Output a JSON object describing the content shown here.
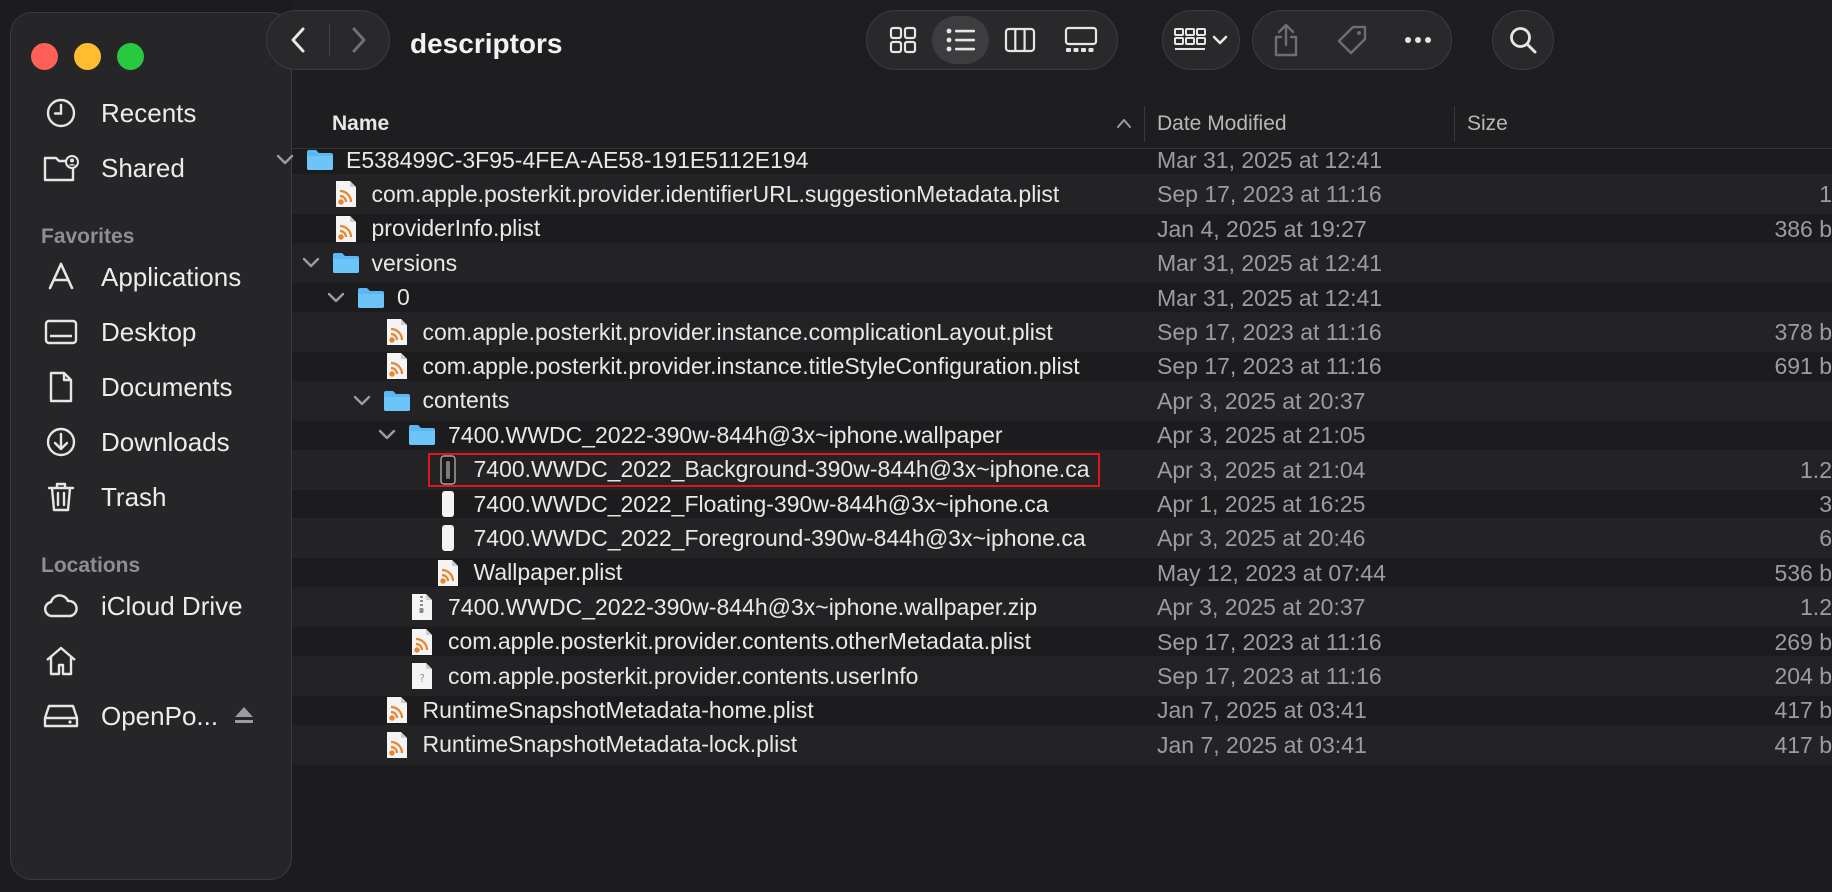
{
  "window": {
    "folder_title": "descriptors"
  },
  "sidebar": {
    "top_items": [
      {
        "label": "Recents",
        "icon": "clock-icon"
      },
      {
        "label": "Shared",
        "icon": "shared-folder-icon"
      }
    ],
    "favorites_title": "Favorites",
    "favorites": [
      {
        "label": "Applications",
        "icon": "applications-icon"
      },
      {
        "label": "Desktop",
        "icon": "desktop-icon"
      },
      {
        "label": "Documents",
        "icon": "document-icon"
      },
      {
        "label": "Downloads",
        "icon": "download-icon"
      },
      {
        "label": "Trash",
        "icon": "trash-icon"
      }
    ],
    "locations_title": "Locations",
    "locations": [
      {
        "label": "iCloud Drive",
        "icon": "cloud-icon"
      },
      {
        "label": "",
        "icon": "home-icon"
      },
      {
        "label": "OpenPo...",
        "icon": "drive-icon"
      }
    ]
  },
  "columns": {
    "name": "Name",
    "date": "Date Modified",
    "size": "Size"
  },
  "files": [
    {
      "name": "E538499C-3F95-4FEA-AE58-191E5112E194",
      "date": "Mar 31, 2025 at 12:41",
      "size": "",
      "level": 0,
      "type": "folder",
      "expanded": true
    },
    {
      "name": "com.apple.posterkit.provider.identifierURL.suggestionMetadata.plist",
      "date": "Sep 17, 2023 at 11:16",
      "size": "1",
      "level": 1,
      "type": "plist"
    },
    {
      "name": "providerInfo.plist",
      "date": "Jan 4, 2025 at 19:27",
      "size": "386 b",
      "level": 1,
      "type": "plist"
    },
    {
      "name": "versions",
      "date": "Mar 31, 2025 at 12:41",
      "size": "",
      "level": 1,
      "type": "folder",
      "expanded": true
    },
    {
      "name": "0",
      "date": "Mar 31, 2025 at 12:41",
      "size": "",
      "level": 2,
      "type": "folder",
      "expanded": true
    },
    {
      "name": "com.apple.posterkit.provider.instance.complicationLayout.plist",
      "date": "Sep 17, 2023 at 11:16",
      "size": "378 b",
      "level": 3,
      "type": "plist"
    },
    {
      "name": "com.apple.posterkit.provider.instance.titleStyleConfiguration.plist",
      "date": "Sep 17, 2023 at 11:16",
      "size": "691 b",
      "level": 3,
      "type": "plist"
    },
    {
      "name": "contents",
      "date": "Apr 3, 2025 at 20:37",
      "size": "",
      "level": 3,
      "type": "folder",
      "expanded": true
    },
    {
      "name": "7400.WWDC_2022-390w-844h@3x~iphone.wallpaper",
      "date": "Apr 3, 2025 at 21:05",
      "size": "",
      "level": 4,
      "type": "folder",
      "expanded": true
    },
    {
      "name": "7400.WWDC_2022_Background-390w-844h@3x~iphone.ca",
      "date": "Apr 3, 2025 at 21:04",
      "size": "1.2",
      "level": 5,
      "type": "ca-dark",
      "selected": true
    },
    {
      "name": "7400.WWDC_2022_Floating-390w-844h@3x~iphone.ca",
      "date": "Apr 1, 2025 at 16:25",
      "size": "3",
      "level": 5,
      "type": "ca"
    },
    {
      "name": "7400.WWDC_2022_Foreground-390w-844h@3x~iphone.ca",
      "date": "Apr 3, 2025 at 20:46",
      "size": "6",
      "level": 5,
      "type": "ca"
    },
    {
      "name": "Wallpaper.plist",
      "date": "May 12, 2023 at 07:44",
      "size": "536 b",
      "level": 5,
      "type": "plist"
    },
    {
      "name": "7400.WWDC_2022-390w-844h@3x~iphone.wallpaper.zip",
      "date": "Apr 3, 2025 at 20:37",
      "size": "1.2",
      "level": 4,
      "type": "zip"
    },
    {
      "name": "com.apple.posterkit.provider.contents.otherMetadata.plist",
      "date": "Sep 17, 2023 at 11:16",
      "size": "269 b",
      "level": 4,
      "type": "plist"
    },
    {
      "name": "com.apple.posterkit.provider.contents.userInfo",
      "date": "Sep 17, 2023 at 11:16",
      "size": "204 b",
      "level": 4,
      "type": "generic"
    },
    {
      "name": "RuntimeSnapshotMetadata-home.plist",
      "date": "Jan 7, 2025 at 03:41",
      "size": "417 b",
      "level": 3,
      "type": "plist"
    },
    {
      "name": "RuntimeSnapshotMetadata-lock.plist",
      "date": "Jan 7, 2025 at 03:41",
      "size": "417 b",
      "level": 3,
      "type": "plist"
    }
  ],
  "colors": {
    "accent_folder": "#5ab8f5",
    "selection_outline": "#e0141c",
    "plist_orange": "#e8852b"
  }
}
